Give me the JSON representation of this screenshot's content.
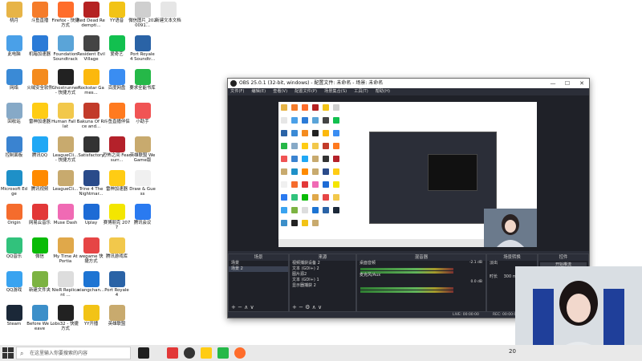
{
  "desktop": {
    "icons": [
      {
        "label": "桃月",
        "color": "#e7b447"
      },
      {
        "label": "斗鱼直播",
        "color": "#f57c2a"
      },
      {
        "label": "Firefox - 快捷方式",
        "color": "#ff6d2b"
      },
      {
        "label": "Red Dead Redempti...",
        "color": "#b52222"
      },
      {
        "label": "YY语音",
        "color": "#f2c316"
      },
      {
        "label": "微信图片_2020091...",
        "color": "#cfcfcf"
      },
      {
        "label": "新建文本文档",
        "color": "#e6e6e6"
      },
      {
        "label": "此电脑",
        "color": "#4aa0e8"
      },
      {
        "label": "机箱加速器",
        "color": "#2b7bd7"
      },
      {
        "label": "Foundation Soundtrack",
        "color": "#5aa4d8"
      },
      {
        "label": "Resident Evil Village",
        "color": "#444"
      },
      {
        "label": "爱奇艺",
        "color": "#12c04f"
      },
      {
        "label": "Port Royale 4 Soundtr...",
        "color": "#2a63a6"
      },
      {
        "label": "网络",
        "color": "#3a8ad6"
      },
      {
        "label": "火绒安全软件",
        "color": "#f48b1e"
      },
      {
        "label": "Ghostrunner - 快捷方式",
        "color": "#222"
      },
      {
        "label": "Rockstar Games...",
        "color": "#fcb80d"
      },
      {
        "label": "百度网盘",
        "color": "#3a8df2"
      },
      {
        "label": "要求全能书库",
        "color": "#25b848"
      },
      {
        "label": "回收站",
        "color": "#86a9c7"
      },
      {
        "label": "雷神加速器",
        "color": "#ffcc14"
      },
      {
        "label": "Human Fall Flat",
        "color": "#f2c84b"
      },
      {
        "label": "Sakuna Of Rice and...",
        "color": "#c23b2a"
      },
      {
        "label": "斗鱼直播伴侣",
        "color": "#ff7a1f"
      },
      {
        "label": "小助手",
        "color": "#f05454"
      },
      {
        "label": "控制面板",
        "color": "#3a83d0"
      },
      {
        "label": "腾讯QQ",
        "color": "#20a8f5"
      },
      {
        "label": "LeagueCli... - 快捷方式",
        "color": "#c8aa6e"
      },
      {
        "label": "Satisfactory",
        "color": "#333"
      },
      {
        "label": "恐怖之间 Fear surr...",
        "color": "#b4212a"
      },
      {
        "label": "英雄联盟 WeGame版",
        "color": "#c8aa6e"
      },
      {
        "label": "Microsoft Edge",
        "color": "#1e90c8"
      },
      {
        "label": "腾讯视频",
        "color": "#ff8a00"
      },
      {
        "label": "LeagueCli...",
        "color": "#c8aa6e"
      },
      {
        "label": "Trine 4 The Nightmar...",
        "color": "#2a4b8a"
      },
      {
        "label": "雷神加速器",
        "color": "#ffcc14"
      },
      {
        "label": "Draw & Guess",
        "color": "#f0f0f0"
      },
      {
        "label": "Origin",
        "color": "#f56c2d"
      },
      {
        "label": "网易云音乐",
        "color": "#e23838"
      },
      {
        "label": "Muse Dash",
        "color": "#f06ab4"
      },
      {
        "label": "Uplay",
        "color": "#1d6bd5"
      },
      {
        "label": "赛博朋克 2077",
        "color": "#f3e600"
      },
      {
        "label": "腾讯会议",
        "color": "#2a7af0"
      },
      {
        "label": "QQ音乐",
        "color": "#31c27c"
      },
      {
        "label": "微信",
        "color": "#09bb07"
      },
      {
        "label": "My Time At Portia",
        "color": "#e0a84a"
      },
      {
        "label": "wegame 快捷方式",
        "color": "#e64545"
      },
      {
        "label": "腾讯游戏库",
        "color": "#f2c84b"
      },
      {
        "label": "QQ游戏",
        "color": "#39a3f0"
      },
      {
        "label": "新建文件夹",
        "color": "#7cb342"
      },
      {
        "label": "NieR Replicant ...",
        "color": "#ddd"
      },
      {
        "label": "xiangchan...",
        "color": "#1d74d3"
      },
      {
        "label": "Port Royale 4",
        "color": "#2a63a6"
      },
      {
        "label": "Steam",
        "color": "#1b2838"
      },
      {
        "label": "Before We Leave",
        "color": "#3c8fc9"
      },
      {
        "label": "obs32 - 快捷方式",
        "color": "#222"
      },
      {
        "label": "YY开播",
        "color": "#f2c316"
      },
      {
        "label": "英雄联盟",
        "color": "#c8aa6e"
      }
    ]
  },
  "obs": {
    "title": "OBS 25.0.1 (32-bit, windows) - 配置文件: 未命名 - 场景: 未命名",
    "menu": [
      "文件(F)",
      "编辑(E)",
      "查看(V)",
      "配置文件(P)",
      "场景集合(S)",
      "工具(T)",
      "帮助(H)"
    ],
    "docks": {
      "scenes": {
        "title": "场景",
        "items": [
          "场景",
          "场景 2"
        ],
        "selected": 1
      },
      "sources": {
        "title": "来源",
        "items": [
          "视频捕获设备 2",
          "文本 (GDI+) 2",
          "图片源2",
          "文本 (GDI+) 1",
          "显示器捕获 2"
        ]
      },
      "mixer": {
        "title": "混音器",
        "channels": [
          {
            "name": "桌面音频",
            "db": "-2.1 dB"
          },
          {
            "name": "麦克风/Aux",
            "db": "0.0 dB"
          }
        ]
      },
      "transitions": {
        "title": "场景转换",
        "type": "淡出",
        "duration_label": "时长",
        "duration": "300 ms"
      },
      "controls": {
        "title": "控件",
        "button": "开始推流"
      }
    },
    "status": {
      "live": "LIVE: 00:00:00",
      "rec": "REC: 00:00:00",
      "cpu": "CPU: 1.9%"
    }
  },
  "taskbar": {
    "search_placeholder": "在这里输入你要搜索的内容",
    "time": "20"
  }
}
